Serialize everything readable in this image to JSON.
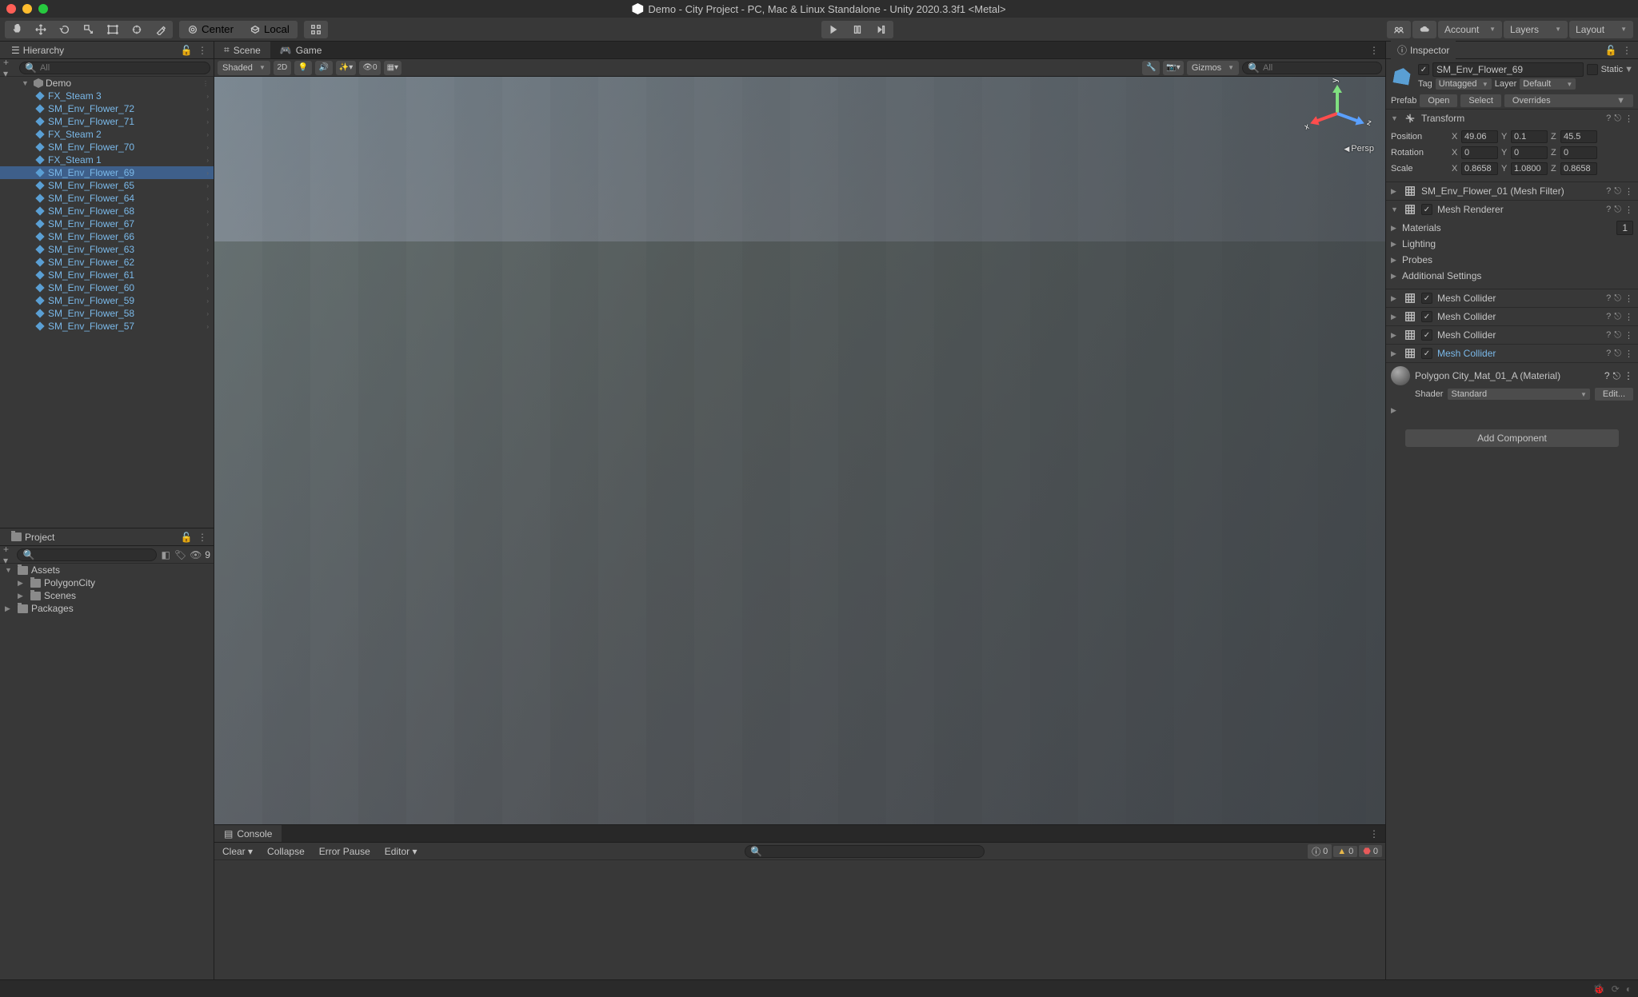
{
  "title": "Demo - City Project - PC, Mac & Linux Standalone - Unity 2020.3.3f1 <Metal>",
  "toolbar": {
    "pivot": "Center",
    "handle": "Local",
    "account": "Account",
    "layers": "Layers",
    "layout": "Layout"
  },
  "hierarchy": {
    "title": "Hierarchy",
    "search_placeholder": "All",
    "scene": "Demo",
    "items": [
      "FX_Steam 3",
      "SM_Env_Flower_72",
      "SM_Env_Flower_71",
      "FX_Steam 2",
      "SM_Env_Flower_70",
      "FX_Steam 1",
      "SM_Env_Flower_69",
      "SM_Env_Flower_65",
      "SM_Env_Flower_64",
      "SM_Env_Flower_68",
      "SM_Env_Flower_67",
      "SM_Env_Flower_66",
      "SM_Env_Flower_63",
      "SM_Env_Flower_62",
      "SM_Env_Flower_61",
      "SM_Env_Flower_60",
      "SM_Env_Flower_59",
      "SM_Env_Flower_58",
      "SM_Env_Flower_57"
    ],
    "selected_index": 6
  },
  "project": {
    "title": "Project",
    "search_placeholder": "",
    "hidden_count": "9",
    "tree": [
      {
        "label": "Assets",
        "depth": 0,
        "expanded": true
      },
      {
        "label": "PolygonCity",
        "depth": 1,
        "expanded": false
      },
      {
        "label": "Scenes",
        "depth": 1,
        "expanded": false
      },
      {
        "label": "Packages",
        "depth": 0,
        "expanded": false
      }
    ]
  },
  "scene": {
    "tab_scene": "Scene",
    "tab_game": "Game",
    "shading": "Shaded",
    "mode2d": "2D",
    "gizmos": "Gizmos",
    "search_placeholder": "All",
    "persp": "Persp",
    "hidden_count": "0"
  },
  "console": {
    "title": "Console",
    "clear": "Clear",
    "collapse": "Collapse",
    "error_pause": "Error Pause",
    "editor": "Editor",
    "counts": {
      "info": "0",
      "warn": "0",
      "error": "0"
    }
  },
  "inspector": {
    "title": "Inspector",
    "object_name": "SM_Env_Flower_69",
    "static": "Static",
    "tag_label": "Tag",
    "tag_value": "Untagged",
    "layer_label": "Layer",
    "layer_value": "Default",
    "prefab_label": "Prefab",
    "prefab_open": "Open",
    "prefab_select": "Select",
    "prefab_overrides": "Overrides",
    "transform": {
      "title": "Transform",
      "position_label": "Position",
      "position": {
        "x": "49.06",
        "y": "0.1",
        "z": "45.5"
      },
      "rotation_label": "Rotation",
      "rotation": {
        "x": "0",
        "y": "0",
        "z": "0"
      },
      "scale_label": "Scale",
      "scale": {
        "x": "0.8658",
        "y": "1.0800",
        "z": "0.8658"
      }
    },
    "mesh_filter": "SM_Env_Flower_01 (Mesh Filter)",
    "mesh_renderer": {
      "title": "Mesh Renderer",
      "materials": "Materials",
      "materials_count": "1",
      "lighting": "Lighting",
      "probes": "Probes",
      "additional": "Additional Settings"
    },
    "mesh_colliders": [
      "Mesh Collider",
      "Mesh Collider",
      "Mesh Collider",
      "Mesh Collider"
    ],
    "material": {
      "title": "Polygon City_Mat_01_A (Material)",
      "shader_label": "Shader",
      "shader_value": "Standard",
      "edit": "Edit..."
    },
    "add_component": "Add Component"
  }
}
